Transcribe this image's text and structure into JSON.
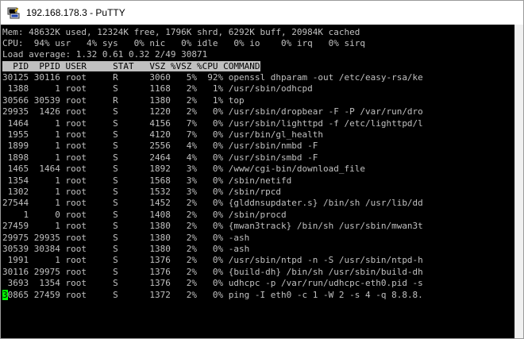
{
  "window": {
    "title": "192.168.178.3 - PuTTY",
    "icon": "putty-terminal-icon"
  },
  "colors": {
    "terminal_bg": "#000000",
    "terminal_fg": "#c0c0c0",
    "header_bg": "#c0c0c0",
    "cursor": "#00ff00"
  },
  "summary": {
    "mem": "Mem: 48632K used, 12324K free, 1796K shrd, 6292K buff, 20984K cached",
    "cpu": "CPU:  94% usr   4% sys   0% nic   0% idle   0% io    0% irq   0% sirq",
    "load": "Load average: 1.32 0.61 0.32 2/49 30871"
  },
  "table": {
    "header": "  PID  PPID USER     STAT   VSZ %VSZ %CPU COMMAND",
    "rows": [
      "30125 30116 root     R      3060   5%  92% openssl dhparam -out /etc/easy-rsa/ke",
      " 1388     1 root     S      1168   2%   1% /usr/sbin/odhcpd",
      "30566 30539 root     R      1380   2%   1% top",
      "29935  1426 root     S      1220   2%   0% /usr/sbin/dropbear -F -P /var/run/dro",
      " 1464     1 root     S      4156   7%   0% /usr/sbin/lighttpd -f /etc/lighttpd/l",
      " 1955     1 root     S      4120   7%   0% /usr/bin/gl_health",
      " 1899     1 root     S      2556   4%   0% /usr/sbin/nmbd -F",
      " 1898     1 root     S      2464   4%   0% /usr/sbin/smbd -F",
      " 1465  1464 root     S      1892   3%   0% /www/cgi-bin/download_file",
      " 1354     1 root     S      1568   3%   0% /sbin/netifd",
      " 1302     1 root     S      1532   3%   0% /sbin/rpcd",
      "27544     1 root     S      1452   2%   0% {glddnsupdater.s} /bin/sh /usr/lib/dd",
      "    1     0 root     S      1408   2%   0% /sbin/procd",
      "27459     1 root     S      1380   2%   0% {mwan3track} /bin/sh /usr/sbin/mwan3t",
      "29975 29935 root     S      1380   2%   0% -ash",
      "30539 30384 root     S      1380   2%   0% -ash",
      " 1991     1 root     S      1376   2%   0% /usr/sbin/ntpd -n -S /usr/sbin/ntpd-h",
      "30116 29975 root     S      1376   2%   0% {build-dh} /bin/sh /usr/sbin/build-dh",
      " 3693  1354 root     S      1376   2%   0% udhcpc -p /var/run/udhcpc-eth0.pid -s"
    ],
    "last_row": {
      "cursor_char": "3",
      "rest": "0865 27459 root     S      1372   2%   0% ping -I eth0 -c 1 -W 2 -s 4 -q 8.8.8."
    }
  }
}
